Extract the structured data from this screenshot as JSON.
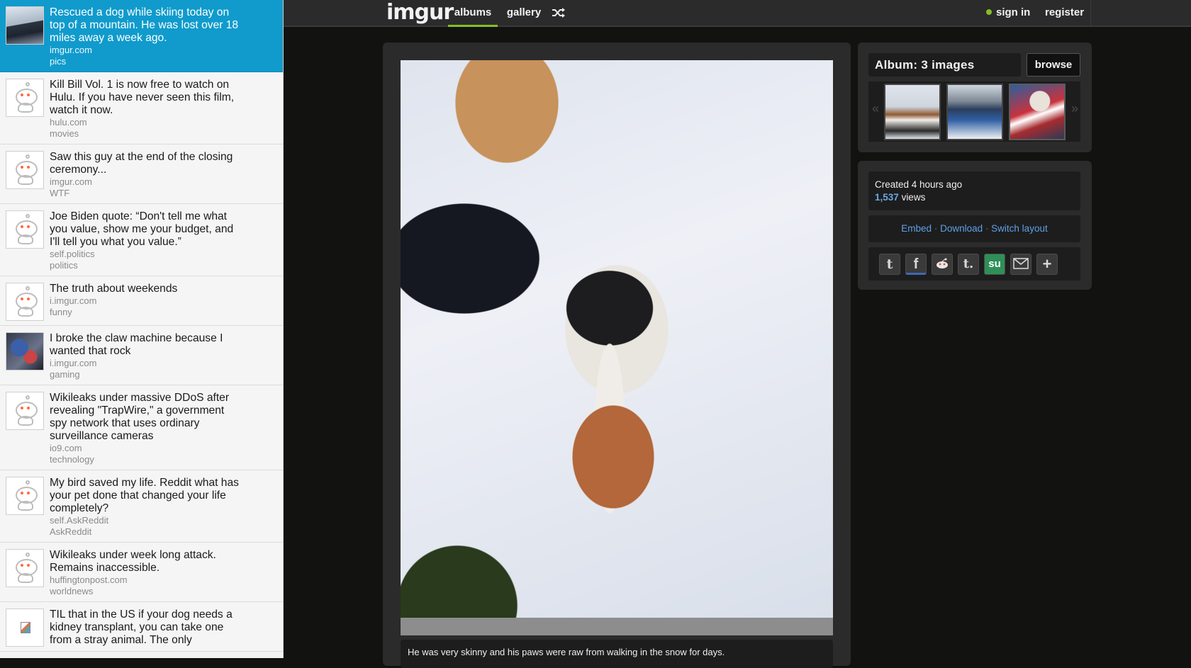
{
  "feed": {
    "items": [
      {
        "title": "Rescued a dog while skiing today on top of a mountain. He was lost over 18 miles away a week ago.",
        "domain": "imgur.com",
        "subreddit": "pics"
      },
      {
        "title": "Kill Bill Vol. 1 is now free to watch on Hulu. If you have never seen this film, watch it now.",
        "domain": "hulu.com",
        "subreddit": "movies"
      },
      {
        "title": "Saw this guy at the end of the closing ceremony...",
        "domain": "imgur.com",
        "subreddit": "WTF"
      },
      {
        "title": "Joe Biden quote: “Don't tell me what you value, show me your budget, and I'll tell you what you value.”",
        "domain": "self.politics",
        "subreddit": "politics"
      },
      {
        "title": "The truth about weekends",
        "domain": "i.imgur.com",
        "subreddit": "funny"
      },
      {
        "title": "I broke the claw machine because I wanted that rock",
        "domain": "i.imgur.com",
        "subreddit": "gaming"
      },
      {
        "title": "Wikileaks under massive DDoS after revealing \"TrapWire,\" a government spy network that uses ordinary surveillance cameras",
        "domain": "io9.com",
        "subreddit": "technology"
      },
      {
        "title": "My bird saved my life. Reddit what has your pet done that changed your life completely?",
        "domain": "self.AskReddit",
        "subreddit": "AskReddit"
      },
      {
        "title": "Wikileaks under week long attack. Remains inaccessible.",
        "domain": "huffingtonpost.com",
        "subreddit": "worldnews"
      },
      {
        "title": "TIL that in the US if your dog needs a kidney transplant, you can take one from a stray animal. The only",
        "domain": "",
        "subreddit": ""
      }
    ]
  },
  "topbar": {
    "logo": "imgur",
    "tabs": {
      "albums": "albums",
      "gallery": "gallery"
    },
    "shuffle_icon": "shuffle-icon",
    "sign_in": "sign in",
    "register": "register",
    "accent_color": "#85bf25"
  },
  "image": {
    "caption": "He was very skinny and his paws were raw from walking in the snow for days."
  },
  "album": {
    "title": "Album: 3 images",
    "browse_label": "browse",
    "prev_arrow": "«",
    "next_arrow": "»"
  },
  "info": {
    "created": "Created 4 hours ago",
    "views_count": "1,537",
    "views_label": "views",
    "links": {
      "embed": "Embed",
      "download": "Download",
      "switch_layout": "Switch layout",
      "separator": "·"
    }
  },
  "share": {
    "icons": [
      "twitter-icon",
      "facebook-icon",
      "reddit-icon",
      "tumblr-icon",
      "stumbleupon-icon",
      "email-icon",
      "plus-icon"
    ],
    "twitter": "t",
    "facebook": "f",
    "tumblr": "t.",
    "stumbleupon": "su",
    "plus": "+"
  }
}
